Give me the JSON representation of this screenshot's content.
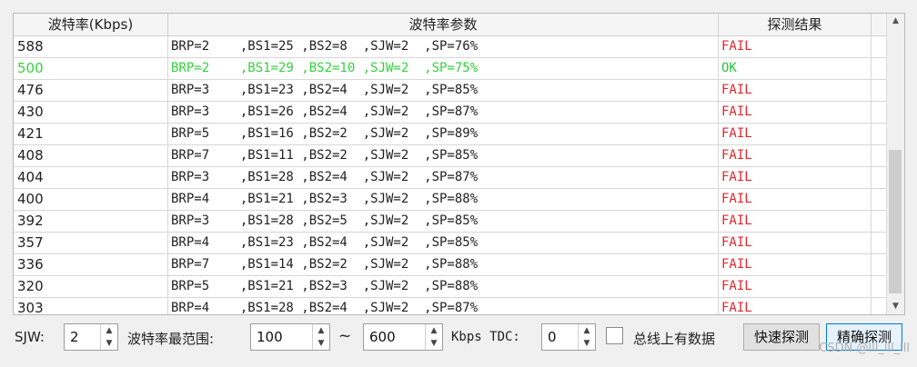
{
  "table": {
    "headers": [
      "波特率(Kbps)",
      "波特率参数",
      "探测结果"
    ],
    "rows": [
      {
        "rate": "588",
        "params": "BRP=2    ,BS1=25 ,BS2=8  ,SJW=2  ,SP=76%",
        "result": "FAIL"
      },
      {
        "rate": "500",
        "params": "BRP=2    ,BS1=29 ,BS2=10 ,SJW=2  ,SP=75%",
        "result": "OK"
      },
      {
        "rate": "476",
        "params": "BRP=3    ,BS1=23 ,BS2=4  ,SJW=2  ,SP=85%",
        "result": "FAIL"
      },
      {
        "rate": "430",
        "params": "BRP=3    ,BS1=26 ,BS2=4  ,SJW=2  ,SP=87%",
        "result": "FAIL"
      },
      {
        "rate": "421",
        "params": "BRP=5    ,BS1=16 ,BS2=2  ,SJW=2  ,SP=89%",
        "result": "FAIL"
      },
      {
        "rate": "408",
        "params": "BRP=7    ,BS1=11 ,BS2=2  ,SJW=2  ,SP=85%",
        "result": "FAIL"
      },
      {
        "rate": "404",
        "params": "BRP=3    ,BS1=28 ,BS2=4  ,SJW=2  ,SP=87%",
        "result": "FAIL"
      },
      {
        "rate": "400",
        "params": "BRP=4    ,BS1=21 ,BS2=3  ,SJW=2  ,SP=88%",
        "result": "FAIL"
      },
      {
        "rate": "392",
        "params": "BRP=3    ,BS1=28 ,BS2=5  ,SJW=2  ,SP=85%",
        "result": "FAIL"
      },
      {
        "rate": "357",
        "params": "BRP=4    ,BS1=23 ,BS2=4  ,SJW=2  ,SP=85%",
        "result": "FAIL"
      },
      {
        "rate": "336",
        "params": "BRP=7    ,BS1=14 ,BS2=2  ,SJW=2  ,SP=88%",
        "result": "FAIL"
      },
      {
        "rate": "320",
        "params": "BRP=5    ,BS1=21 ,BS2=3  ,SJW=2  ,SP=88%",
        "result": "FAIL"
      },
      {
        "rate": "303",
        "params": "BRP=4    ,BS1=28 ,BS2=4  ,SJW=2  ,SP=87%",
        "result": "FAIL"
      }
    ]
  },
  "controls": {
    "sjw_label": "SJW:",
    "sjw_value": "2",
    "range_label": "波特率最范围:",
    "range_min": "100",
    "range_sep": "~",
    "range_max": "600",
    "unit_tdc_label": "Kbps TDC:",
    "tdc_value": "0",
    "bus_data_label": "总线上有数据",
    "fast_detect_label": "快速探测",
    "precise_detect_label": "精确探测"
  },
  "watermark": "CSDN @lll_lll_lll",
  "colors": {
    "fail": "#e3262c",
    "ok": "#22c63a"
  }
}
